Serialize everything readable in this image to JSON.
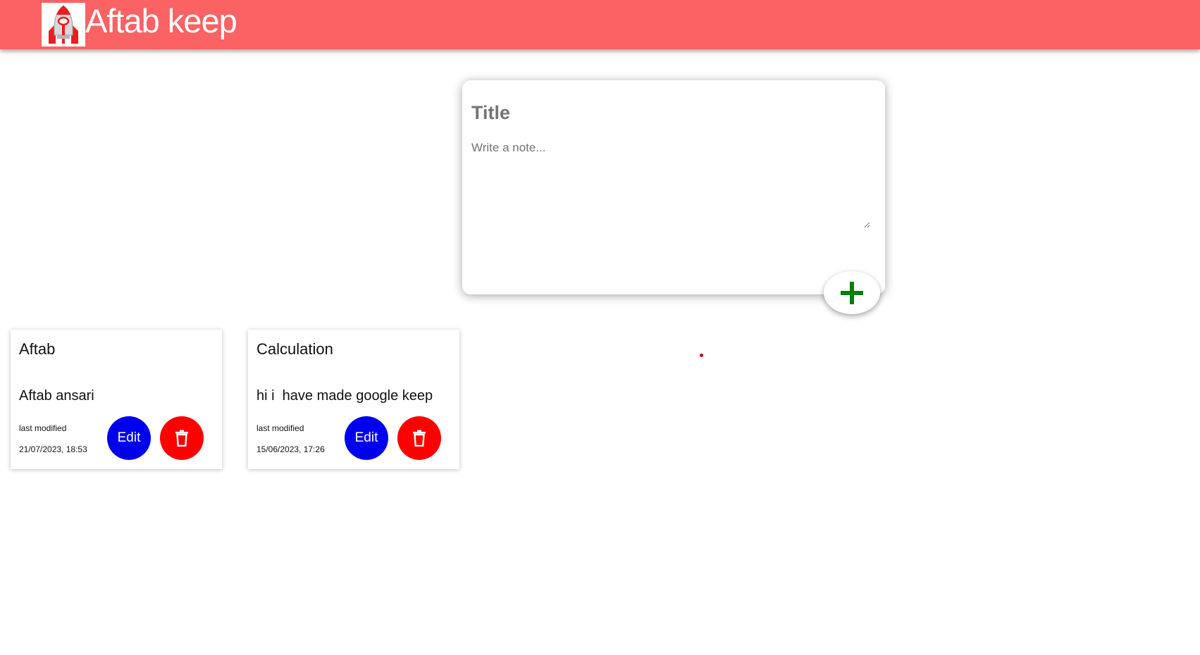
{
  "header": {
    "app_title": "Aftab keep",
    "logo_icon": "rocket-logo-icon",
    "background_color": "#fb6263"
  },
  "composer": {
    "title_placeholder": "Title",
    "title_value": "",
    "note_placeholder": "Write a note...",
    "note_value": "",
    "add_icon": "plus-icon",
    "add_icon_color": "#0a7d0a"
  },
  "notes": [
    {
      "title": "Aftab",
      "content": "Aftab ansari",
      "modified_label": "last modified",
      "modified_date": "21/07/2023, 18:53",
      "edit_label": "Edit",
      "delete_icon": "trash-icon"
    },
    {
      "title": "Calculation",
      "content": "hi i  have made google keep",
      "modified_label": "last modified",
      "modified_date": "15/06/2023, 17:26",
      "edit_label": "Edit",
      "delete_icon": "trash-icon"
    }
  ],
  "colors": {
    "edit_button": "#0000ee",
    "delete_button": "#ff0000"
  }
}
